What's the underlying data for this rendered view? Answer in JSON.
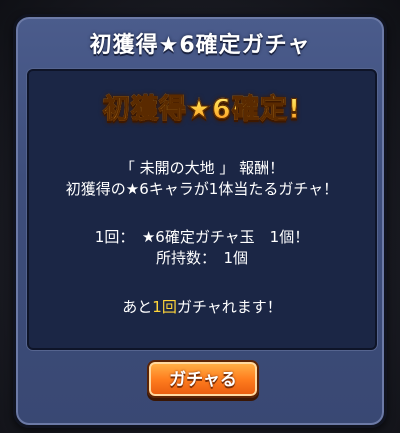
{
  "dialog": {
    "title": "初獲得★6確定ガチャ",
    "headline": "初獲得★6確定!",
    "line1": "「 未開の大地 」 報酬！",
    "line2": "初獲得の★6キャラが1体当たるガチャ！",
    "line3": "1回：　★6確定ガチャ玉　1個！",
    "line4": "所持数：　1個",
    "remaining_prefix": "あと",
    "remaining_count": "1回",
    "remaining_suffix": "ガチャれます！",
    "button_label": "ガチャる"
  },
  "colors": {
    "accent": "#ffd53a",
    "button": "#ff7e1f",
    "dialog": "#3e4e7c",
    "panel": "#1b2645"
  }
}
